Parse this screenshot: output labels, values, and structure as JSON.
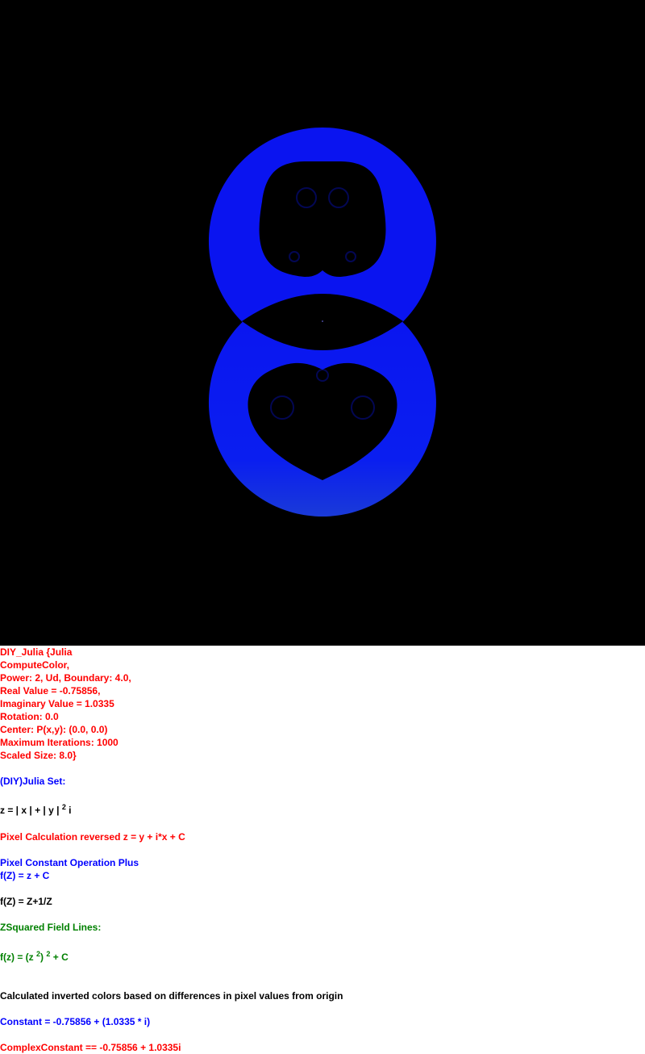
{
  "params": [
    "DIY_Julia {Julia",
    "ComputeColor,",
    "Power: 2, Ud, Boundary: 4.0,",
    "Real Value = -0.75856,",
    "Imaginary Value = 1.0335",
    "Rotation: 0.0",
    "Center: P(x,y): (0.0, 0.0)",
    "Maximum Iterations: 1000",
    "Scaled Size: 8.0}"
  ],
  "julia_title": "(DIY)Julia Set:",
  "formula1": {
    "base": "z = | x | + | y |",
    "exp": "2",
    "tail": "i"
  },
  "pixel_calc": "Pixel Calculation reversed z = y + i*x + C",
  "pixel_const_title": "Pixel Constant Operation Plus",
  "pixel_const_formula": "f(Z) = z + C",
  "f_z": "f(Z) = Z+1/Z",
  "field_lines": "ZSquared Field Lines:",
  "formula2": {
    "a": "f(z) = (z",
    "e1": "2",
    "b": ")",
    "e2": "2",
    "c": "+ C"
  },
  "inverted_colors": "Calculated inverted colors based on differences in pixel values from origin",
  "constant": "Constant = -0.75856 + (1.0335 * i)",
  "complex_constant": "ComplexConstant == -0.75856 + 1.0335i",
  "colors": {
    "background": "#000000",
    "fractal": "#0a14f0",
    "fractal_glow": "#1a3ad8"
  }
}
